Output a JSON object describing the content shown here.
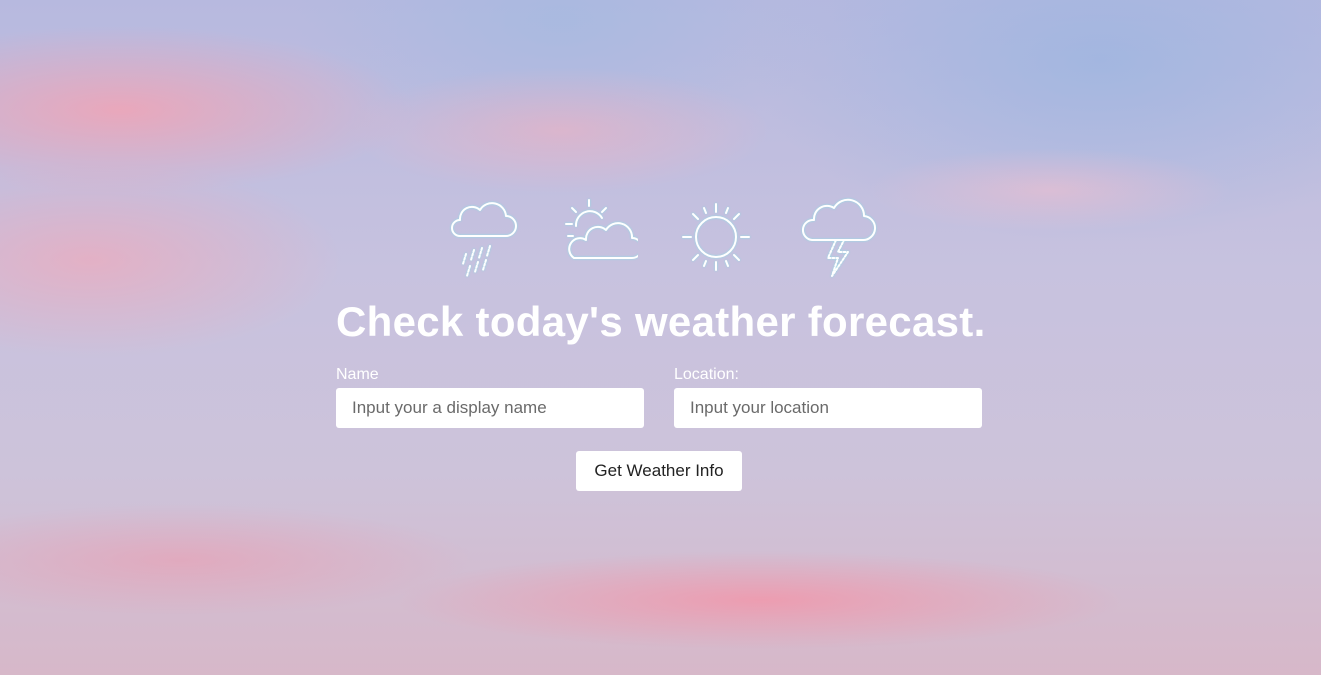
{
  "icons": [
    "rain-cloud-icon",
    "partly-sunny-icon",
    "sun-icon",
    "thunderstorm-icon"
  ],
  "heading": "Check today's weather forecast.",
  "form": {
    "name_label": "Name",
    "name_placeholder": "Input your a display name",
    "location_label": "Location:",
    "location_placeholder": "Input your location",
    "submit_label": "Get Weather Info"
  },
  "colors": {
    "text": "#ffffff",
    "icon_stroke": "#ffffff",
    "icon_glow": "#9fe3e8"
  }
}
